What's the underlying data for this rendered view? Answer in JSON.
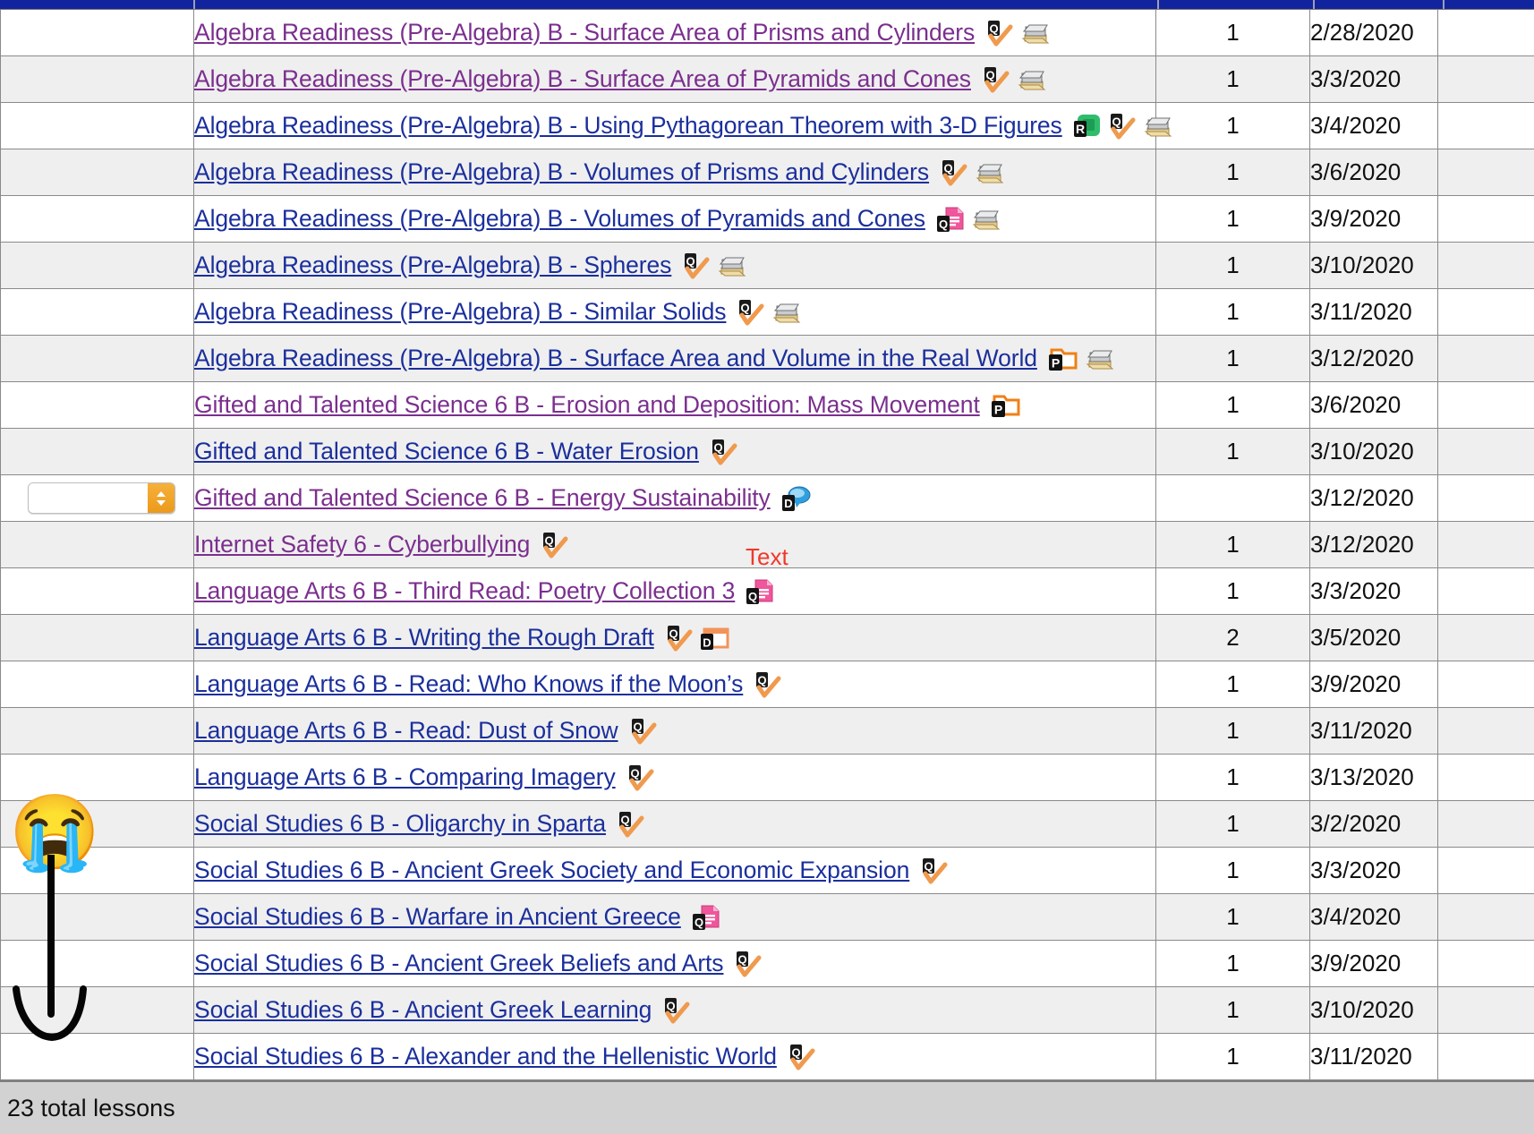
{
  "header": {
    "bar_color": "#12239e",
    "segments": [
      216,
      1075,
      172,
      143,
      108
    ]
  },
  "colors": {
    "visited_link": "#7b2f8e",
    "unvisited_link": "#1b2f9c",
    "row_alt": "#efefef",
    "footer_bg": "#d2d2d2",
    "annotation_red": "#f0392b",
    "select_accent": "#eb9a1c"
  },
  "select": {
    "value": "",
    "placeholder": "",
    "icon": "chevron-updown-icon"
  },
  "table": {
    "rows": [
      {
        "title": "Algebra Readiness (Pre-Algebra) B - Surface Area of Prisms and Cylinders",
        "link_state": "visited",
        "icons": [
          "quiz-check-icon",
          "archive-box-icon"
        ],
        "count": "1",
        "date": "2/28/2020",
        "has_select": false
      },
      {
        "title": "Algebra Readiness (Pre-Algebra) B - Surface Area of Pyramids and Cones",
        "link_state": "visited",
        "icons": [
          "quiz-check-icon",
          "archive-box-icon"
        ],
        "count": "1",
        "date": "3/3/2020",
        "has_select": false
      },
      {
        "title": "Algebra Readiness (Pre-Algebra) B - Using Pythagorean Theorem with 3-D Figures",
        "link_state": "unvisited",
        "icons": [
          "green-r-icon",
          "quiz-check-icon",
          "archive-box-icon"
        ],
        "count": "1",
        "date": "3/4/2020",
        "has_select": false
      },
      {
        "title": "Algebra Readiness (Pre-Algebra) B - Volumes of Prisms and Cylinders",
        "link_state": "unvisited",
        "icons": [
          "quiz-check-icon",
          "archive-box-icon"
        ],
        "count": "1",
        "date": "3/6/2020",
        "has_select": false
      },
      {
        "title": "Algebra Readiness (Pre-Algebra) B - Volumes of Pyramids and Cones",
        "link_state": "unvisited",
        "icons": [
          "pink-doc-icon",
          "archive-box-icon"
        ],
        "count": "1",
        "date": "3/9/2020",
        "has_select": false
      },
      {
        "title": "Algebra Readiness (Pre-Algebra) B - Spheres",
        "link_state": "unvisited",
        "icons": [
          "quiz-check-icon",
          "archive-box-icon"
        ],
        "count": "1",
        "date": "3/10/2020",
        "has_select": false
      },
      {
        "title": "Algebra Readiness (Pre-Algebra) B - Similar Solids",
        "link_state": "unvisited",
        "icons": [
          "quiz-check-icon",
          "archive-box-icon"
        ],
        "count": "1",
        "date": "3/11/2020",
        "has_select": false
      },
      {
        "title": "Algebra Readiness (Pre-Algebra) B - Surface Area and Volume in the Real World",
        "link_state": "unvisited",
        "icons": [
          "orange-p-folder-icon",
          "archive-box-icon"
        ],
        "count": "1",
        "date": "3/12/2020",
        "has_select": false
      },
      {
        "title": "Gifted and Talented Science 6 B - Erosion and Deposition: Mass Movement",
        "link_state": "visited",
        "icons": [
          "orange-p-folder-icon"
        ],
        "count": "1",
        "date": "3/6/2020",
        "has_select": false
      },
      {
        "title": "Gifted and Talented Science 6 B - Water Erosion",
        "link_state": "unvisited",
        "icons": [
          "quiz-check-icon"
        ],
        "count": "1",
        "date": "3/10/2020",
        "has_select": false
      },
      {
        "title": "Gifted and Talented Science 6 B - Energy Sustainability",
        "link_state": "visited",
        "icons": [
          "discussion-d-icon"
        ],
        "count": "",
        "date": "3/12/2020",
        "has_select": true
      },
      {
        "title": "Internet Safety 6 - Cyberbullying",
        "link_state": "visited",
        "icons": [
          "quiz-check-icon"
        ],
        "count": "1",
        "date": "3/12/2020",
        "has_select": false
      },
      {
        "title": "Language Arts 6 B - Third Read: Poetry Collection 3",
        "link_state": "visited",
        "icons": [
          "pink-doc-icon"
        ],
        "count": "1",
        "date": "3/3/2020",
        "has_select": false
      },
      {
        "title": "Language Arts 6 B - Writing the Rough Draft",
        "link_state": "unvisited",
        "icons": [
          "quiz-check-icon",
          "orange-d-doc-icon"
        ],
        "count": "2",
        "date": "3/5/2020",
        "has_select": false
      },
      {
        "title": "Language Arts 6 B - Read: Who Knows if the Moon’s",
        "link_state": "unvisited",
        "icons": [
          "quiz-check-icon"
        ],
        "count": "1",
        "date": "3/9/2020",
        "has_select": false
      },
      {
        "title": "Language Arts 6 B - Read: Dust of Snow",
        "link_state": "unvisited",
        "icons": [
          "quiz-check-icon"
        ],
        "count": "1",
        "date": "3/11/2020",
        "has_select": false
      },
      {
        "title": "Language Arts 6 B - Comparing Imagery",
        "link_state": "unvisited",
        "icons": [
          "quiz-check-icon"
        ],
        "count": "1",
        "date": "3/13/2020",
        "has_select": false
      },
      {
        "title": "Social Studies 6 B - Oligarchy in Sparta",
        "link_state": "unvisited",
        "icons": [
          "quiz-check-icon"
        ],
        "count": "1",
        "date": "3/2/2020",
        "has_select": false
      },
      {
        "title": "Social Studies 6 B - Ancient Greek Society and Economic Expansion",
        "link_state": "unvisited",
        "icons": [
          "quiz-check-icon"
        ],
        "count": "1",
        "date": "3/3/2020",
        "has_select": false
      },
      {
        "title": "Social Studies 6 B - Warfare in Ancient Greece",
        "link_state": "unvisited",
        "icons": [
          "pink-doc-icon"
        ],
        "count": "1",
        "date": "3/4/2020",
        "has_select": false
      },
      {
        "title": "Social Studies 6 B - Ancient Greek Beliefs and Arts",
        "link_state": "unvisited",
        "icons": [
          "quiz-check-icon"
        ],
        "count": "1",
        "date": "3/9/2020",
        "has_select": false
      },
      {
        "title": "Social Studies 6 B - Ancient Greek Learning",
        "link_state": "unvisited",
        "icons": [
          "quiz-check-icon"
        ],
        "count": "1",
        "date": "3/10/2020",
        "has_select": false
      },
      {
        "title": "Social Studies 6 B - Alexander and the Hellenistic World",
        "link_state": "unvisited",
        "icons": [
          "quiz-check-icon"
        ],
        "count": "1",
        "date": "3/11/2020",
        "has_select": false
      }
    ]
  },
  "footer": {
    "total_text": "23 total lessons"
  },
  "annotations": {
    "text_label": "Text",
    "emoji": "😭",
    "emoji_name": "loudly-crying-face-emoji",
    "arrow_name": "hand-drawn-down-arrow"
  }
}
